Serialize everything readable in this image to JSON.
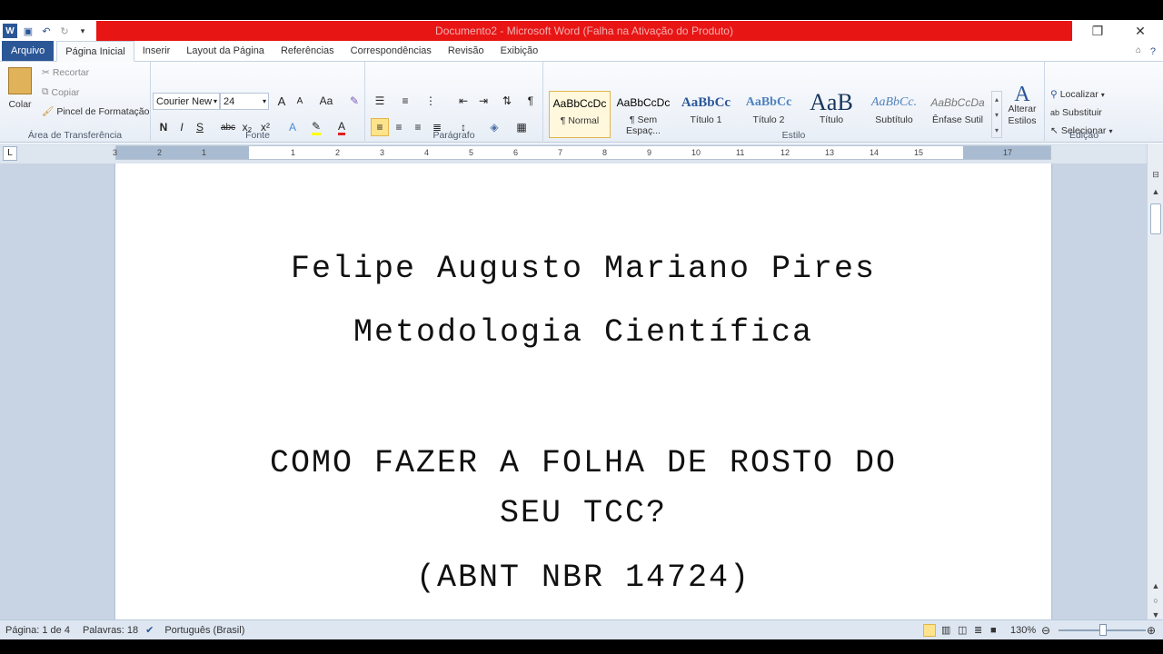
{
  "app": {
    "title": "Documento2  -  Microsoft Word (Falha na Ativação do Produto)"
  },
  "tabs": [
    "Arquivo",
    "Página Inicial",
    "Inserir",
    "Layout da Página",
    "Referências",
    "Correspondências",
    "Revisão",
    "Exibição"
  ],
  "clipboard": {
    "paste": "Colar",
    "cut": "Recortar",
    "copy": "Copiar",
    "painter": "Pincel de Formatação",
    "label": "Área de Transferência"
  },
  "font": {
    "name": "Courier New",
    "size": "24",
    "label": "Fonte",
    "bold": "N",
    "italic": "I",
    "underline": "S",
    "strike": "abc",
    "sub": "x₂",
    "sup": "x²",
    "grow": "A",
    "shrink": "A",
    "case": "Aa"
  },
  "paragraph": {
    "label": "Parágrafo",
    "pilcrow": "¶"
  },
  "styles": {
    "label": "Estilo",
    "items": [
      {
        "preview": "AaBbCcDc",
        "name": "¶ Normal"
      },
      {
        "preview": "AaBbCcDc",
        "name": "¶ Sem Espaç..."
      },
      {
        "preview": "AaBbCc",
        "name": "Título 1"
      },
      {
        "preview": "AaBbCc",
        "name": "Título 2"
      },
      {
        "preview": "AaB",
        "name": "Título"
      },
      {
        "preview": "AaBbCc.",
        "name": "Subtítulo"
      },
      {
        "preview": "AaBbCcDa",
        "name": "Ênfase Sutil"
      }
    ],
    "change": "Alterar Estilos"
  },
  "editing": {
    "label": "Edição",
    "find": "Localizar",
    "replace": "Substituir",
    "select": "Selecionar"
  },
  "ruler": {
    "ticks": [
      "3",
      "2",
      "1",
      "",
      "1",
      "2",
      "3",
      "4",
      "5",
      "6",
      "7",
      "8",
      "9",
      "10",
      "11",
      "12",
      "13",
      "14",
      "15",
      "",
      "17"
    ]
  },
  "document": {
    "lines": [
      "Felipe Augusto Mariano Pires",
      "Metodologia Científica",
      "COMO FAZER A FOLHA DE ROSTO DO",
      "SEU TCC?",
      "(ABNT NBR 14724)"
    ]
  },
  "status": {
    "page": "Página: 1 de 4",
    "words": "Palavras: 18",
    "language": "Português (Brasil)",
    "zoom": "130%"
  }
}
